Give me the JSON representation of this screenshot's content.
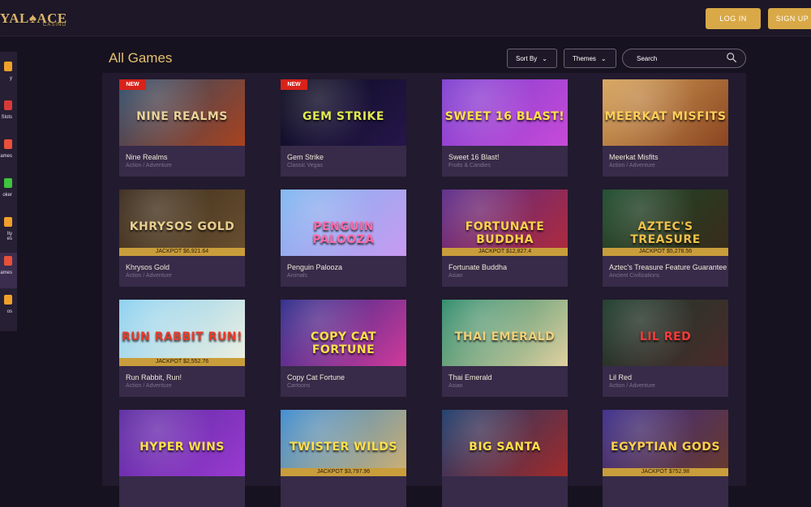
{
  "header": {
    "logo_text": "YAL♠ACE",
    "logo_sub": "CASINO",
    "login_label": "LOG IN",
    "signup_label": "SIGN UP"
  },
  "sidebar": {
    "items": [
      {
        "label": "y",
        "icon": "star-icon",
        "color": "#f0a02a"
      },
      {
        "label": "Slots",
        "icon": "slot-icon",
        "color": "#d83a3a"
      },
      {
        "label": "ames",
        "icon": "table-games-icon",
        "color": "#e8503a"
      },
      {
        "label": "oker",
        "icon": "poker-icon",
        "color": "#3ec43e"
      },
      {
        "label": "lty\nes",
        "icon": "specialty-icon",
        "color": "#f0a02a"
      },
      {
        "label": "ames",
        "icon": "all-games-icon",
        "color": "#e8503a"
      },
      {
        "label": "os",
        "icon": "promos-icon",
        "color": "#f0a02a"
      }
    ]
  },
  "toolbar": {
    "title": "All Games",
    "sort_label": "Sort By",
    "themes_label": "Themes",
    "search_placeholder": "Search"
  },
  "games": [
    {
      "name": "Nine Realms",
      "category": "Action / Adventure",
      "thumb_title": "NINE REALMS",
      "badge": "NEW",
      "jackpot": "",
      "colors": [
        "#2a4a6a",
        "#a8421e"
      ],
      "title_color": "#e9d39a"
    },
    {
      "name": "Gem Strike",
      "category": "Classic Vegas",
      "thumb_title": "GEM STRIKE",
      "badge": "NEW",
      "jackpot": "",
      "colors": [
        "#0b0b1e",
        "#25164a"
      ],
      "title_color": "#e0e850"
    },
    {
      "name": "Sweet 16 Blast!",
      "category": "Fruits & Candies",
      "thumb_title": "SWEET 16 BLAST!",
      "badge": "",
      "jackpot": "",
      "colors": [
        "#7c3fd0",
        "#c84ad8"
      ],
      "title_color": "#ffe04a"
    },
    {
      "name": "Meerkat Misfits",
      "category": "Action / Adventure",
      "thumb_title": "MEERKAT MISFITS",
      "badge": "",
      "jackpot": "",
      "colors": [
        "#d6a35a",
        "#8a4420"
      ],
      "title_color": "#ffcf5a"
    },
    {
      "name": "Khrysos Gold",
      "category": "Action / Adventure",
      "thumb_title": "KHRYSOS GOLD",
      "badge": "",
      "jackpot": "JACKPOT $6,921.64",
      "colors": [
        "#3a2a1a",
        "#6a5030"
      ],
      "title_color": "#e8cf90"
    },
    {
      "name": "Penguin Palooza",
      "category": "Animals",
      "thumb_title": "PENGUIN PALOOZA",
      "badge": "",
      "jackpot": "",
      "colors": [
        "#7db6f0",
        "#c89af0"
      ],
      "title_color": "#ff6aa8"
    },
    {
      "name": "Fortunate Buddha",
      "category": "Asian",
      "thumb_title": "FORTUNATE BUDDHA",
      "badge": "",
      "jackpot": "JACKPOT $12,827.4",
      "colors": [
        "#5a2a8a",
        "#b02a3a"
      ],
      "title_color": "#ffd24a"
    },
    {
      "name": "Aztec's Treasure Feature Guarantee",
      "category": "Ancient Civilizations",
      "thumb_title": "AZTEC'S TREASURE",
      "badge": "",
      "jackpot": "JACKPOT $5,278.56",
      "colors": [
        "#1a4a2a",
        "#3a2a1a"
      ],
      "title_color": "#f0c04a"
    },
    {
      "name": "Run Rabbit, Run!",
      "category": "Action / Adventure",
      "thumb_title": "RUN RABBIT RUN!",
      "badge": "",
      "jackpot": "JACKPOT $2,552.76",
      "colors": [
        "#8ad0f0",
        "#f0f0e0"
      ],
      "title_color": "#e83a2a"
    },
    {
      "name": "Copy Cat Fortune",
      "category": "Cartoons",
      "thumb_title": "COPY CAT FORTUNE",
      "badge": "",
      "jackpot": "",
      "colors": [
        "#2a2a8a",
        "#d03a9a"
      ],
      "title_color": "#ffe04a"
    },
    {
      "name": "Thai Emerald",
      "category": "Asian",
      "thumb_title": "THAI EMERALD",
      "badge": "",
      "jackpot": "",
      "colors": [
        "#2a8a6a",
        "#e0d0a0"
      ],
      "title_color": "#f0d07a"
    },
    {
      "name": "Lil Red",
      "category": "Action / Adventure",
      "thumb_title": "LIL RED",
      "badge": "",
      "jackpot": "",
      "colors": [
        "#1a3a2a",
        "#4a2a2a"
      ],
      "title_color": "#ff3a3a"
    },
    {
      "name": "",
      "category": "",
      "thumb_title": "HYPER WINS",
      "badge": "",
      "jackpot": "",
      "colors": [
        "#5a2aa0",
        "#9a3ad0"
      ],
      "title_color": "#ffe04a"
    },
    {
      "name": "",
      "category": "",
      "thumb_title": "TWISTER WILDS",
      "badge": "",
      "jackpot": "JACKPOT $3,797.96",
      "colors": [
        "#3a8ad0",
        "#d0b070"
      ],
      "title_color": "#ffe04a"
    },
    {
      "name": "",
      "category": "",
      "thumb_title": "BIG SANTA",
      "badge": "",
      "jackpot": "",
      "colors": [
        "#1a3a6a",
        "#a02a2a"
      ],
      "title_color": "#ffe04a"
    },
    {
      "name": "",
      "category": "",
      "thumb_title": "EGYPTIAN GODS",
      "badge": "",
      "jackpot": "JACKPOT $752.98",
      "colors": [
        "#3a2a8a",
        "#6a3a2a"
      ],
      "title_color": "#ffd04a"
    }
  ]
}
